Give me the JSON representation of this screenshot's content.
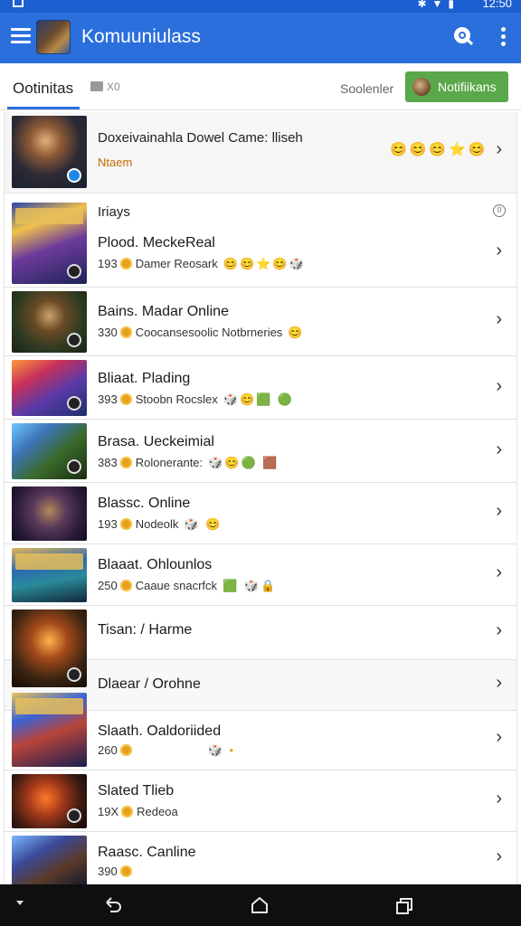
{
  "status_bar": {
    "time": "12:50"
  },
  "app_bar": {
    "title": "Komuuniulass"
  },
  "tabs": {
    "active": "Ootinitas",
    "extra": "X0",
    "sort_label": "Soolenler",
    "notif_button": "Notifiikans"
  },
  "featured": {
    "title": "Doxeivainahla Dowel Came: lliseh",
    "subtitle": "Ntaem",
    "emojis": "😊😊😊⭐😊"
  },
  "section": {
    "label": "Iriays",
    "icon": "0"
  },
  "rows": [
    {
      "title": "Plood. MeckeReal",
      "count": "193",
      "sub": "Damer",
      "sub2": "Reosark",
      "emojis": "😊😊⭐😊🎲"
    },
    {
      "title": "Bains. Madar Online",
      "count": "330",
      "sub": "Coocansesoolic",
      "sub2": "Notbrneries",
      "emojis": "😊"
    },
    {
      "title": "Bliaat. Plading",
      "count": "393",
      "sub": "Stoobn Rocslex",
      "sub2": "",
      "emojis": "🎲😊🟩 🟢"
    },
    {
      "title": "Brasa. Ueckeimial",
      "count": "383",
      "sub": "Rolonerante:",
      "sub2": "",
      "emojis": "🎲😊🟢 🟫"
    },
    {
      "title": "Blassc. Online",
      "count": "193",
      "sub": "Nodeolk",
      "sub2": "",
      "emojis": "🎲 😊"
    },
    {
      "title": "Blaaat. Ohlounlos",
      "count": "250",
      "sub": "Caaue snacrfck",
      "sub2": "",
      "emojis": "🟩 🎲🔒"
    },
    {
      "title": "Tisan: / Harme",
      "count": "",
      "sub": "",
      "sub2": "",
      "emojis": ""
    },
    {
      "title": "Dlaear / Orohne",
      "count": "",
      "sub": "",
      "sub2": "",
      "emojis": ""
    },
    {
      "title": "Slaath. Oaldoriided",
      "count": "260",
      "sub": "",
      "sub2": "",
      "emojis": "🎲 •"
    },
    {
      "title": "Slated Tlieb",
      "count": "19X",
      "sub": "Redeoa",
      "sub2": "",
      "emojis": ""
    },
    {
      "title": "Raasc. Canline",
      "count": "390",
      "sub": "",
      "sub2": "",
      "emojis": ""
    }
  ]
}
